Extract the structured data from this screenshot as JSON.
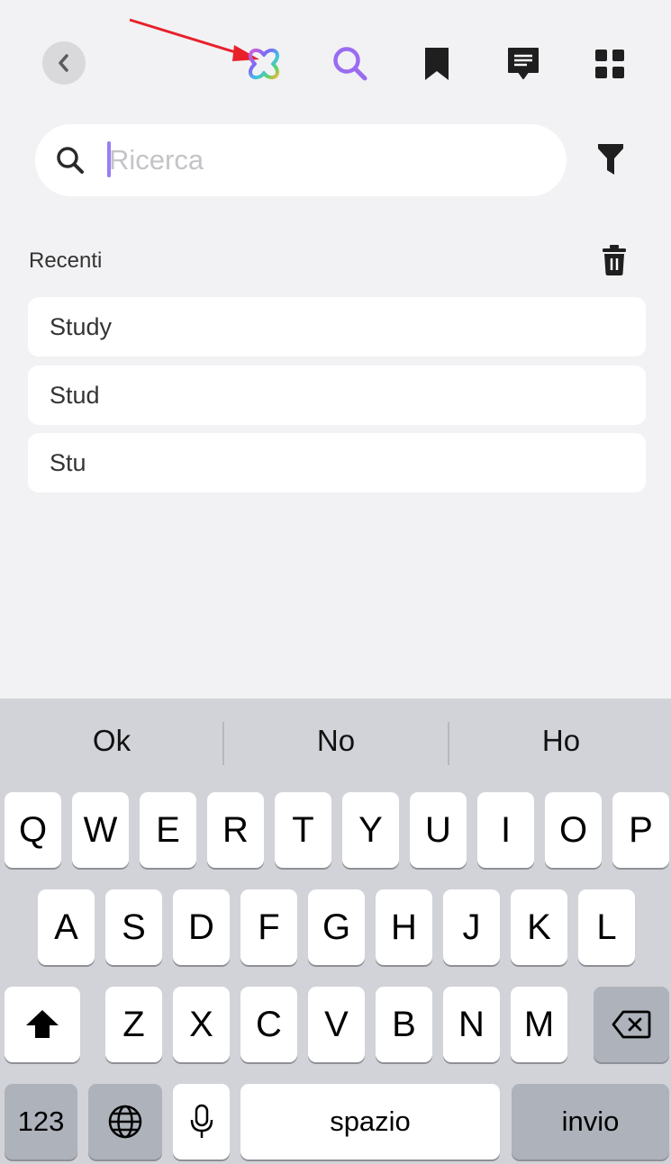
{
  "header": {
    "back_icon": "chevron-left-icon",
    "icons": [
      "ai-flower-icon",
      "search-icon",
      "bookmark-icon",
      "chat-icon",
      "grid-icon"
    ],
    "accent_color": "#9a6cf0",
    "annotation_arrow_color": "#e8202a"
  },
  "search": {
    "placeholder": "Ricerca",
    "value": "",
    "filter_icon": "filter-icon"
  },
  "recent": {
    "title": "Recenti",
    "clear_icon": "trash-icon",
    "items": [
      "Study",
      "Stud",
      "Stu"
    ]
  },
  "keyboard": {
    "suggestions": [
      "Ok",
      "No",
      "Ho"
    ],
    "row1": [
      "Q",
      "W",
      "E",
      "R",
      "T",
      "Y",
      "U",
      "I",
      "O",
      "P"
    ],
    "row2": [
      "A",
      "S",
      "D",
      "F",
      "G",
      "H",
      "J",
      "K",
      "L"
    ],
    "row3": [
      "Z",
      "X",
      "C",
      "V",
      "B",
      "N",
      "M"
    ],
    "numbers_label": "123",
    "space_label": "spazio",
    "return_label": "invio"
  }
}
